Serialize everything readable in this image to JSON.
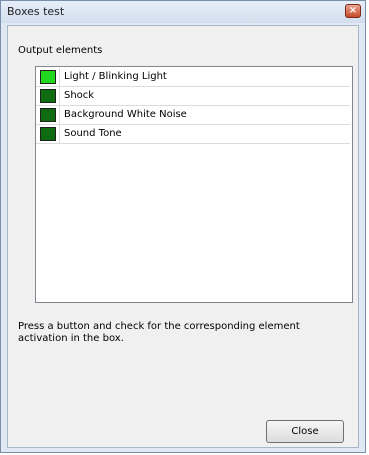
{
  "window": {
    "title": "Boxes test",
    "close_glyph": "×"
  },
  "group": {
    "label": "Output elements"
  },
  "items": [
    {
      "label": "Light / Blinking Light",
      "color": "#22d81e",
      "active": true
    },
    {
      "label": "Shock",
      "color": "#0f6b12",
      "active": false
    },
    {
      "label": "Background White Noise",
      "color": "#0f6b12",
      "active": false
    },
    {
      "label": "Sound Tone",
      "color": "#0f6b12",
      "active": false
    }
  ],
  "instructions": "Press a button and check for the corresponding element activation in the box.",
  "buttons": {
    "close": "Close"
  }
}
